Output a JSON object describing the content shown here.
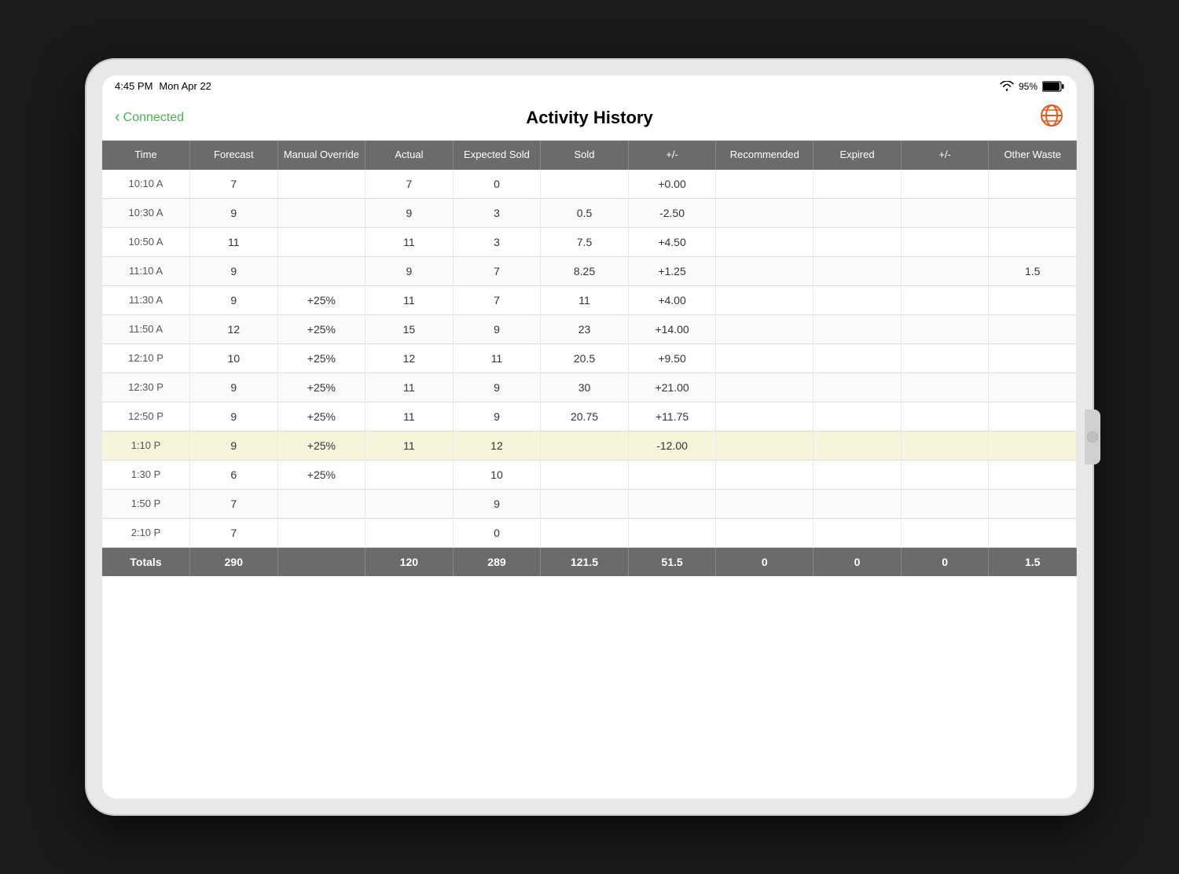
{
  "status_bar": {
    "time": "4:45 PM",
    "date": "Mon Apr 22",
    "wifi_signal": "WiFi",
    "battery_percent": "95%"
  },
  "nav": {
    "back_label": "Connected",
    "title": "Activity History",
    "globe_label": "Globe"
  },
  "table": {
    "headers": [
      "Time",
      "Forecast",
      "Manual Override",
      "Actual",
      "Expected Sold",
      "Sold",
      "+/-",
      "Recommended",
      "Expired",
      "+/-",
      "Other Waste"
    ],
    "rows": [
      {
        "time": "10:10 A",
        "forecast": "7",
        "manual_override": "",
        "actual": "7",
        "expected_sold": "0",
        "sold": "",
        "plusminus1": "+0.00",
        "recommended": "",
        "expired": "",
        "plusminus2": "",
        "other_waste": "",
        "highlighted": false
      },
      {
        "time": "10:30 A",
        "forecast": "9",
        "manual_override": "",
        "actual": "9",
        "expected_sold": "3",
        "sold": "0.5",
        "plusminus1": "-2.50",
        "recommended": "",
        "expired": "",
        "plusminus2": "",
        "other_waste": "",
        "highlighted": false
      },
      {
        "time": "10:50 A",
        "forecast": "11",
        "manual_override": "",
        "actual": "11",
        "expected_sold": "3",
        "sold": "7.5",
        "plusminus1": "+4.50",
        "recommended": "",
        "expired": "",
        "plusminus2": "",
        "other_waste": "",
        "highlighted": false
      },
      {
        "time": "11:10 A",
        "forecast": "9",
        "manual_override": "",
        "actual": "9",
        "expected_sold": "7",
        "sold": "8.25",
        "plusminus1": "+1.25",
        "recommended": "",
        "expired": "",
        "plusminus2": "",
        "other_waste": "1.5",
        "highlighted": false
      },
      {
        "time": "11:30 A",
        "forecast": "9",
        "manual_override": "+25%",
        "actual": "11",
        "expected_sold": "7",
        "sold": "11",
        "plusminus1": "+4.00",
        "recommended": "",
        "expired": "",
        "plusminus2": "",
        "other_waste": "",
        "highlighted": false
      },
      {
        "time": "11:50 A",
        "forecast": "12",
        "manual_override": "+25%",
        "actual": "15",
        "expected_sold": "9",
        "sold": "23",
        "plusminus1": "+14.00",
        "recommended": "",
        "expired": "",
        "plusminus2": "",
        "other_waste": "",
        "highlighted": false
      },
      {
        "time": "12:10 P",
        "forecast": "10",
        "manual_override": "+25%",
        "actual": "12",
        "expected_sold": "11",
        "sold": "20.5",
        "plusminus1": "+9.50",
        "recommended": "",
        "expired": "",
        "plusminus2": "",
        "other_waste": "",
        "highlighted": false
      },
      {
        "time": "12:30 P",
        "forecast": "9",
        "manual_override": "+25%",
        "actual": "11",
        "expected_sold": "9",
        "sold": "30",
        "plusminus1": "+21.00",
        "recommended": "",
        "expired": "",
        "plusminus2": "",
        "other_waste": "",
        "highlighted": false
      },
      {
        "time": "12:50 P",
        "forecast": "9",
        "manual_override": "+25%",
        "actual": "11",
        "expected_sold": "9",
        "sold": "20.75",
        "plusminus1": "+11.75",
        "recommended": "",
        "expired": "",
        "plusminus2": "",
        "other_waste": "",
        "highlighted": false
      },
      {
        "time": "1:10 P",
        "forecast": "9",
        "manual_override": "+25%",
        "actual": "11",
        "expected_sold": "12",
        "sold": "",
        "plusminus1": "-12.00",
        "recommended": "",
        "expired": "",
        "plusminus2": "",
        "other_waste": "",
        "highlighted": true
      },
      {
        "time": "1:30 P",
        "forecast": "6",
        "manual_override": "+25%",
        "actual": "",
        "expected_sold": "10",
        "sold": "",
        "plusminus1": "",
        "recommended": "",
        "expired": "",
        "plusminus2": "",
        "other_waste": "",
        "highlighted": false
      },
      {
        "time": "1:50 P",
        "forecast": "7",
        "manual_override": "",
        "actual": "",
        "expected_sold": "9",
        "sold": "",
        "plusminus1": "",
        "recommended": "",
        "expired": "",
        "plusminus2": "",
        "other_waste": "",
        "highlighted": false
      },
      {
        "time": "2:10 P",
        "forecast": "7",
        "manual_override": "",
        "actual": "",
        "expected_sold": "0",
        "sold": "",
        "plusminus1": "",
        "recommended": "",
        "expired": "",
        "plusminus2": "",
        "other_waste": "",
        "highlighted": false
      }
    ],
    "totals": {
      "label": "Totals",
      "forecast": "290",
      "manual_override": "",
      "actual": "120",
      "expected_sold": "289",
      "sold": "121.5",
      "plusminus1": "51.5",
      "recommended": "0",
      "expired": "0",
      "plusminus2": "0",
      "other_waste": "1.5"
    }
  }
}
